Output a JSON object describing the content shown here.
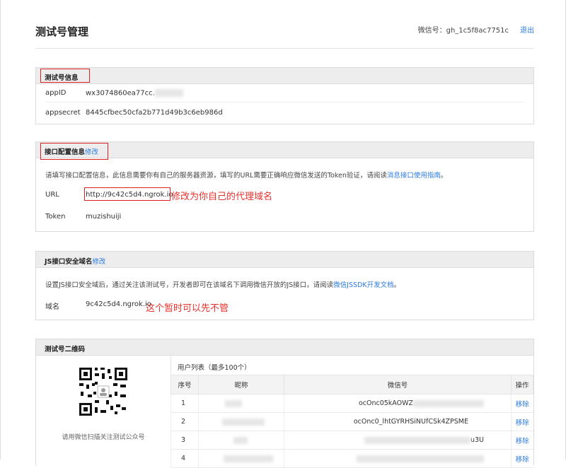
{
  "header": {
    "page_title": "测试号管理",
    "account_label": "微信号：",
    "account_id": "gh_1c5f8ac7751c",
    "logout": "退出"
  },
  "test_info": {
    "title": "测试号信息",
    "appid_label": "appID",
    "appid_value": "wx3074860ea77cc.",
    "appsecret_label": "appsecret",
    "appsecret_value": "8445cfbec50cfa2b771d49b3c6eb986d"
  },
  "interface_config": {
    "title": "接口配置信息",
    "edit": "修改",
    "description": "请填写接口配置信息，此信息需要你有自己的服务器资源，填写的URL需要正确响应微信发送的Token验证，请阅读",
    "doc_link": "消息接口使用指南",
    "desc_end": "。",
    "url_label": "URL",
    "url_value": "http://9c42c5d4.ngrok.io",
    "url_annotation": "修改为你自己的代理域名",
    "token_label": "Token",
    "token_value": "muzishuiji"
  },
  "js_security": {
    "title": "JS接口安全域名",
    "edit": "修改",
    "description": "设置JS接口安全域后，通过关注该测试号，开发者即可在该域名下调用微信开放的JS接口，请阅读",
    "doc_link": "微信JSSDK开发文档",
    "desc_end": "。",
    "domain_label": "域名",
    "domain_value": "9c42c5d4.ngrok.io",
    "domain_annotation": "这个暂时可以先不管"
  },
  "qrcode": {
    "title": "测试号二维码",
    "caption": "请用微信扫描关注测试公众号",
    "user_list_title": "用户列表（最多100个）",
    "columns": [
      "序号",
      "昵称",
      "微信号",
      "操作"
    ],
    "rows": [
      {
        "index": "1",
        "wechat_id": "ocOnc05kAOWZ",
        "action": "移除"
      },
      {
        "index": "2",
        "wechat_id": "ocOnc0_lhtGYRHSiNUfCSk4ZPSME",
        "action": "移除"
      },
      {
        "index": "3",
        "wechat_id": "u3U",
        "action": "移除"
      },
      {
        "index": "4",
        "wechat_id": "",
        "action": "移除"
      }
    ]
  }
}
